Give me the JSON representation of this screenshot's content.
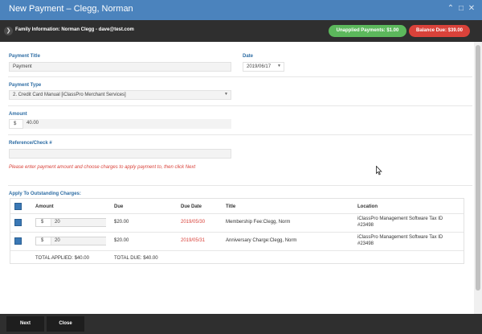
{
  "window": {
    "title": "New Payment – Clegg, Norman"
  },
  "info_bar": {
    "family_information": "Family Information: Norman Clegg - dave@test.com",
    "unapplied_payments": "Unapplied Payments: $1.00",
    "balance_due": "Balance Due: $39.00",
    "colors": {
      "unapplied": "#5cb85c",
      "balance_due": "#d9423a"
    }
  },
  "form": {
    "payment_title": {
      "label": "Payment Title",
      "value": "Payment"
    },
    "date": {
      "label": "Date",
      "value": "2019/06/17"
    },
    "payment_type": {
      "label": "Payment Type",
      "value": "2. Credit Card Manual [iClassPro Merchant Services]"
    },
    "amount": {
      "label": "Amount",
      "currency": "$",
      "value": "40.00"
    },
    "reference": {
      "label": "Reference/Check #",
      "value": ""
    },
    "warning": "Please enter payment amount and choose charges to apply payment to, then click Next"
  },
  "charges": {
    "heading": "Apply To Outstanding Charges:",
    "columns": [
      "Amount",
      "Due",
      "Due Date",
      "Title",
      "Location"
    ],
    "rows": [
      {
        "currency": "$",
        "amount": "20",
        "due": "$20.00",
        "due_date": "2019/05/30",
        "title": "Membership Fee:Clegg, Norm",
        "location_line1": "iClassPro Management Software Tax ID",
        "location_line2": "#23498"
      },
      {
        "currency": "$",
        "amount": "20",
        "due": "$20.00",
        "due_date": "2019/05/31",
        "title": "Anniversary Charge:Clegg, Norm",
        "location_line1": "iClassPro Management Software Tax ID",
        "location_line2": "#23498"
      }
    ],
    "total_applied": "TOTAL APPLIED: $40.00",
    "total_due": "TOTAL DUE: $40.00"
  },
  "footer": {
    "next_label": "Next",
    "close_label": "Close"
  }
}
